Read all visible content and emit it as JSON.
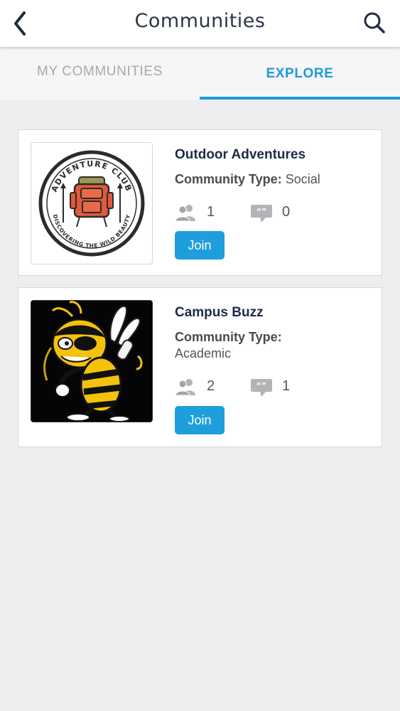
{
  "header": {
    "title": "Communities",
    "back_icon": "chevron-left-icon",
    "search_icon": "search-icon"
  },
  "tabs": [
    {
      "label": "MY COMMUNITIES",
      "active": false
    },
    {
      "label": "EXPLORE",
      "active": true
    }
  ],
  "colors": {
    "accent": "#1d9bd8",
    "title_text": "#1f2c44",
    "background": "#eeeef0"
  },
  "communities": [
    {
      "name": "Outdoor Adventures",
      "type_label": "Community Type:",
      "type": "Social",
      "members": "1",
      "comments": "0",
      "join_label": "Join",
      "image": {
        "icon": "adventure-club-logo",
        "badge_top": "ADVENTURE CLUB",
        "badge_bottom": "DISCOVERING THE WILD BEAUTY"
      }
    },
    {
      "name": "Campus Buzz",
      "type_label": "Community Type:",
      "type": "Academic",
      "members": "2",
      "comments": "1",
      "join_label": "Join",
      "image": {
        "icon": "yellow-jacket-mascot"
      }
    }
  ]
}
